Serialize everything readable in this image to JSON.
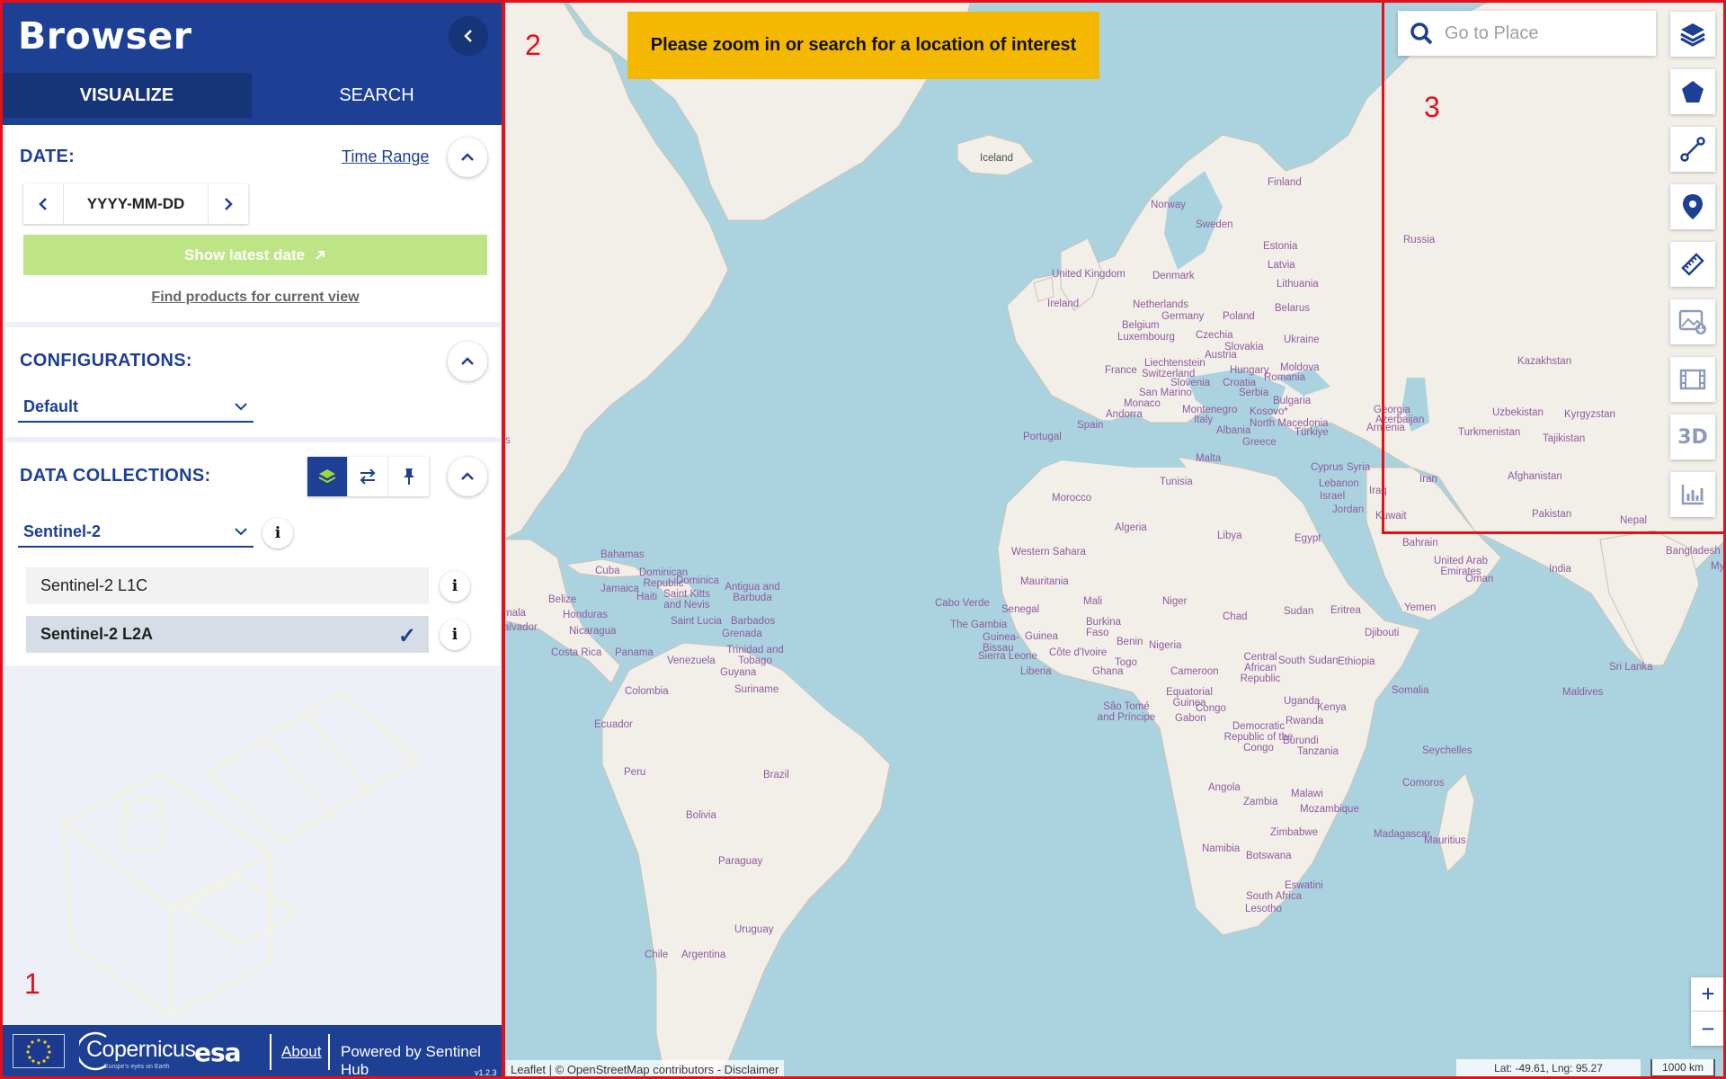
{
  "sidebar": {
    "brand": "Browser",
    "tabs": [
      {
        "label": "VISUALIZE",
        "active": true
      },
      {
        "label": "SEARCH",
        "active": false
      }
    ],
    "date": {
      "title": "DATE:",
      "time_range_link": "Time Range",
      "value": "YYYY-MM-DD",
      "show_latest": "Show latest date",
      "find_products": "Find products for current view"
    },
    "configurations": {
      "title": "CONFIGURATIONS:",
      "selected": "Default"
    },
    "collections": {
      "title": "DATA COLLECTIONS:",
      "selected": "Sentinel-2",
      "info": "i",
      "items": [
        {
          "label": "Sentinel-2 L1C",
          "selected": false
        },
        {
          "label": "Sentinel-2 L2A",
          "selected": true
        }
      ]
    },
    "footer": {
      "copernicus": "Copernicus",
      "copernicus_tagline": "Europe's eyes on Earth",
      "esa": "esa",
      "about": "About",
      "powered": "Powered by Sentinel Hub",
      "version": "v1.2.3"
    }
  },
  "map": {
    "banner": "Please zoom in or search for a location of interest",
    "search_placeholder": "Go to Place",
    "attribution": "Leaflet | © OpenStreetMap contributors - Disclaimer",
    "coords": "Lat: -49.61, Lng: 95.27",
    "scale": "1000 km",
    "zoom_in": "+",
    "zoom_out": "−",
    "tool_3d": "3D",
    "labels": {
      "iceland": "Iceland",
      "finland": "Finland",
      "norway": "Norway",
      "sweden": "Sweden",
      "estonia": "Estonia",
      "latvia": "Latvia",
      "lithuania": "Lithuania",
      "uk": "United Kingdom",
      "denmark": "Denmark",
      "ireland": "Ireland",
      "netherlands": "Netherlands",
      "germany": "Germany",
      "poland": "Poland",
      "belarus": "Belarus",
      "belgium": "Belgium",
      "luxembourg": "Luxembourg",
      "czechia": "Czechia",
      "slovakia": "Slovakia",
      "ukraine": "Ukraine",
      "austria": "Austria",
      "france": "France",
      "liechtenstein": "Liechtenstein",
      "switzerland": "Switzerland",
      "hungary": "Hungary",
      "moldova": "Moldova",
      "slovenia": "Slovenia",
      "croatia": "Croatia",
      "romania": "Romania",
      "san_marino": "San Marino",
      "serbia": "Serbia",
      "monaco": "Monaco",
      "bulgaria": "Bulgaria",
      "andorra": "Andorra",
      "montenegro": "Montenegro",
      "kosovo": "Kosovo*",
      "italy": "Italy",
      "north_macedonia": "North Macedonia",
      "portugal": "Portugal",
      "spain": "Spain",
      "albania": "Albania",
      "turkiye": "Türkiye",
      "greece": "Greece",
      "malta": "Malta",
      "cyprus": "Cyprus",
      "syria": "Syria",
      "tunisia": "Tunisia",
      "lebanon": "Lebanon",
      "israel": "Israel",
      "jordan": "Jordan",
      "morocco": "Morocco",
      "algeria": "Algeria",
      "libya": "Libya",
      "egypt": "Egypt",
      "western_sahara": "Western Sahara",
      "mauritania": "Mauritania",
      "mali": "Mali",
      "niger": "Niger",
      "chad": "Chad",
      "sudan": "Sudan",
      "eritrea": "Eritrea",
      "yemen": "Yemen",
      "cabo_verde": "Cabo Verde",
      "senegal": "Senegal",
      "gambia": "The Gambia",
      "burkina": "Burkina Faso",
      "guinea_bissau": "Guinea-Bissau",
      "guinea": "Guinea",
      "sierra_leone": "Sierra Leone",
      "cote": "Côte d'Ivoire",
      "benin": "Benin",
      "nigeria": "Nigeria",
      "djibouti": "Djibouti",
      "liberia": "Liberia",
      "ghana": "Ghana",
      "togo": "Togo",
      "car": "Central African Republic",
      "south_sudan": "South Sudan",
      "ethiopia": "Ethiopia",
      "cameroon": "Cameroon",
      "somalia": "Somalia",
      "sao_tome": "São Tomé and Príncipe",
      "eq_guinea": "Equatorial Guinea",
      "congo": "Congo",
      "gabon": "Gabon",
      "uganda": "Uganda",
      "kenya": "Kenya",
      "drc": "Democratic Republic of the Congo",
      "rwanda": "Rwanda",
      "burundi": "Burundi",
      "tanzania": "Tanzania",
      "seychelles": "Seychelles",
      "angola": "Angola",
      "comoros": "Comoros",
      "zambia": "Zambia",
      "malawi": "Malawi",
      "mozambique": "Mozambique",
      "zimbabwe": "Zimbabwe",
      "madagascar": "Madagascar",
      "mauritius": "Mauritius",
      "namibia": "Namibia",
      "botswana": "Botswana",
      "eswatini": "Eswatini",
      "south_africa": "South Africa",
      "lesotho": "Lesotho",
      "russia": "Russia",
      "kazakhstan": "Kazakhstan",
      "georgia": "Georgia",
      "azerbaijan": "Azerbaijan",
      "armenia": "Armenia",
      "uzbekistan": "Uzbekistan",
      "kyrgyzstan": "Kyrgyzstan",
      "turkmenistan": "Turkmenistan",
      "tajikistan": "Tajikistan",
      "iran": "Iran",
      "afghanistan": "Afghanistan",
      "iraq": "Iraq",
      "kuwait": "Kuwait",
      "pakistan": "Pakistan",
      "nepal": "Nepal",
      "bahrain": "Bahrain",
      "bangladesh": "Bangladesh",
      "uae": "United Arab Emirates",
      "oman": "Oman",
      "india": "India",
      "sri_lanka": "Sri Lanka",
      "maldives": "Maldives",
      "bahamas": "Bahamas",
      "cuba": "Cuba",
      "dominican": "Dominican Republic",
      "haiti": "Haiti",
      "jamaica": "Jamaica",
      "dominica": "Dominica",
      "antigua": "Antigua and Barbuda",
      "st_kitts": "Saint Kitts and Nevis",
      "belize": "Belize",
      "st_lucia": "Saint Lucia",
      "barbados": "Barbados",
      "honduras": "Honduras",
      "grenada": "Grenada",
      "guatemala": "mala",
      "salvador": "alvador",
      "nicaragua": "Nicaragua",
      "trinidad": "Trinidad and Tobago",
      "costa_rica": "Costa Rica",
      "panama": "Panama",
      "venezuela": "Venezuela",
      "guyana": "Guyana",
      "suriname": "Suriname",
      "colombia": "Colombia",
      "ecuador": "Ecuador",
      "peru": "Peru",
      "brazil": "Brazil",
      "bolivia": "Bolivia",
      "paraguay": "Paraguay",
      "uruguay": "Uruguay",
      "chile": "Chile",
      "argentina": "Argentina",
      "my": "My",
      "s_edge": "s"
    }
  },
  "annotations": [
    "1",
    "2",
    "3"
  ]
}
